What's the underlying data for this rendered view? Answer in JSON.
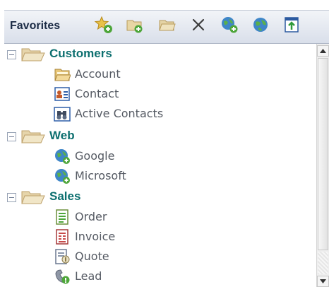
{
  "toolbar": {
    "title": "Favorites",
    "buttons": [
      {
        "name": "add-favorite-button",
        "icon": "star-add-icon"
      },
      {
        "name": "add-folder-button",
        "icon": "folder-add-icon"
      },
      {
        "name": "open-folder-button",
        "icon": "folder-open-icon"
      },
      {
        "name": "delete-button",
        "icon": "close-icon"
      },
      {
        "name": "add-web-link-button",
        "icon": "globe-add-icon"
      },
      {
        "name": "web-button",
        "icon": "globe-icon"
      },
      {
        "name": "export-button",
        "icon": "window-arrow-icon"
      }
    ]
  },
  "tree": {
    "groups": [
      {
        "label": "Customers",
        "expanded": true,
        "items": [
          {
            "label": "Account",
            "icon": "account-folder-icon"
          },
          {
            "label": "Contact",
            "icon": "contact-card-icon"
          },
          {
            "label": "Active Contacts",
            "icon": "binoculars-icon"
          }
        ]
      },
      {
        "label": "Web",
        "expanded": true,
        "items": [
          {
            "label": "Google",
            "icon": "globe-link-icon"
          },
          {
            "label": "Microsoft",
            "icon": "globe-link-icon"
          }
        ]
      },
      {
        "label": "Sales",
        "expanded": true,
        "items": [
          {
            "label": "Order",
            "icon": "order-document-icon"
          },
          {
            "label": "Invoice",
            "icon": "invoice-document-icon"
          },
          {
            "label": "Quote",
            "icon": "quote-document-icon"
          },
          {
            "label": "Lead",
            "icon": "lead-phone-icon"
          }
        ]
      }
    ]
  },
  "colors": {
    "group_label": "#0c6f6f",
    "item_label": "#555a63",
    "toolbar_title": "#1b2b45"
  }
}
